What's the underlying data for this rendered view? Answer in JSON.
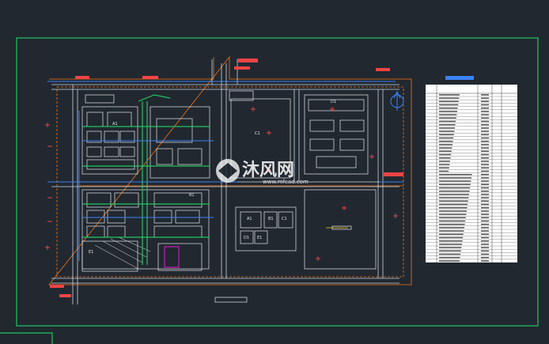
{
  "drawing": {
    "region_labels": [
      {
        "id": "a1",
        "text": "A1"
      },
      {
        "id": "b1",
        "text": "B1"
      },
      {
        "id": "c1",
        "text": "C1"
      },
      {
        "id": "d1",
        "text": "D1"
      },
      {
        "id": "e1",
        "text": "E1"
      },
      {
        "id": "a1b",
        "text": "A1"
      },
      {
        "id": "b1b",
        "text": "B1"
      },
      {
        "id": "c1b",
        "text": "C1"
      },
      {
        "id": "d1b",
        "text": "D1"
      },
      {
        "id": "e1b",
        "text": "E1"
      }
    ]
  },
  "watermark": {
    "brand_cn": "沐风网",
    "url": "www.mfcad.com"
  },
  "colors": {
    "background": "#212830",
    "frame": "#22c55e",
    "road": "#e5e7eb",
    "boundary": "#f97316",
    "pipe_green": "#22c55e",
    "pipe_blue": "#3b82f6",
    "marker_red": "#ef4444",
    "magenta": "#e11dd0",
    "table_bg": "#ffffff",
    "watermark": "#ffffff"
  }
}
